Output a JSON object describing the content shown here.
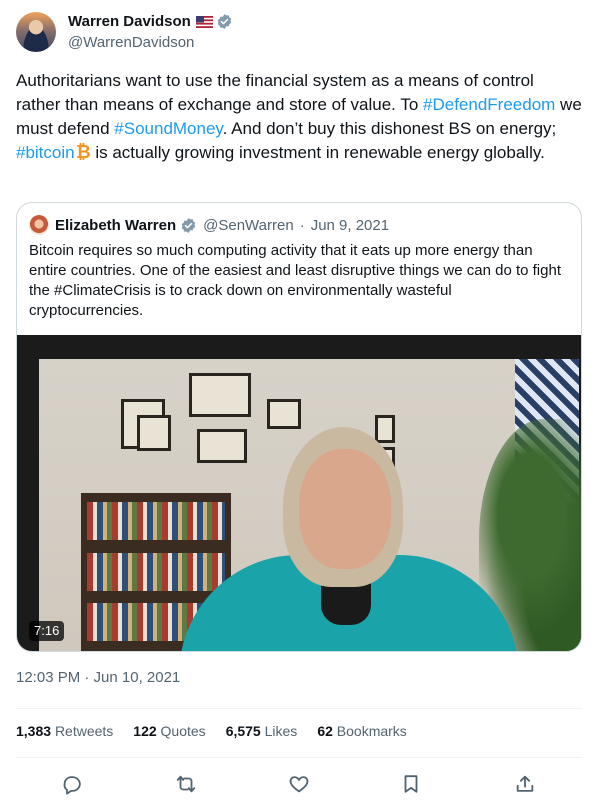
{
  "author": {
    "name": "Warren Davidson",
    "handle": "@WarrenDavidson",
    "flag_icon": "us-flag-icon",
    "verified_icon": "verified-badge-icon"
  },
  "tweet": {
    "segments": [
      "Authoritarians want to use the financial system as a means of control rather than means of exchange and store of value. To ",
      "#DefendFreedom",
      " we must defend ",
      "#SoundMoney",
      ". And don’t buy this dishonest BS on energy; ",
      "#bitcoin",
      " is actually growing investment in renewable energy globally."
    ],
    "hashtag_color": "#1d9bf0"
  },
  "quote": {
    "name": "Elizabeth Warren",
    "handle": "@SenWarren",
    "separator": "·",
    "date": "Jun 9, 2021",
    "text": "Bitcoin requires so much computing activity that it eats up more energy than entire countries. One of the easiest and least disruptive things we can do to fight the #ClimateCrisis is to crack down on environmentally wasteful cryptocurrencies.",
    "video_duration": "7:16"
  },
  "timestamp": "12:03 PM · Jun 10, 2021",
  "stats": {
    "retweets_count": "1,383",
    "retweets_label": "Retweets",
    "quotes_count": "122",
    "quotes_label": "Quotes",
    "likes_count": "6,575",
    "likes_label": "Likes",
    "bookmarks_count": "62",
    "bookmarks_label": "Bookmarks"
  },
  "actions": [
    "reply-icon",
    "retweet-icon",
    "like-icon",
    "bookmark-icon",
    "share-icon"
  ]
}
